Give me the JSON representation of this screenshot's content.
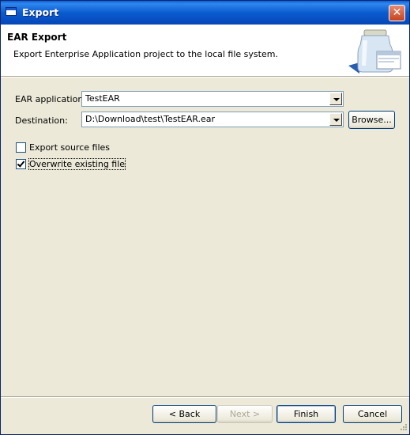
{
  "window": {
    "title": "Export",
    "close_glyph": "✕"
  },
  "header": {
    "title": "EAR Export",
    "description": "Export Enterprise Application project to the local file system."
  },
  "form": {
    "ear_label": "EAR application:",
    "ear_value": "TestEAR",
    "destination_label": "Destination:",
    "destination_value": "D:\\Download\\test\\TestEAR.ear",
    "browse_label": "Browse...",
    "export_source_label": "Export source files",
    "export_source_checked": false,
    "overwrite_label": "Overwrite existing file",
    "overwrite_checked": true
  },
  "buttons": {
    "back": "< Back",
    "next": "Next >",
    "finish": "Finish",
    "cancel": "Cancel"
  },
  "icons": [
    "window-icon",
    "close-icon",
    "jar-export-icon",
    "dropdown-arrow-icon",
    "checkmark-icon",
    "size-grip-icon"
  ],
  "colors": {
    "titlebar": "#0a5ccf",
    "dialog_bg": "#ece9d8",
    "close": "#c5431c",
    "field_border": "#7f9db9"
  }
}
